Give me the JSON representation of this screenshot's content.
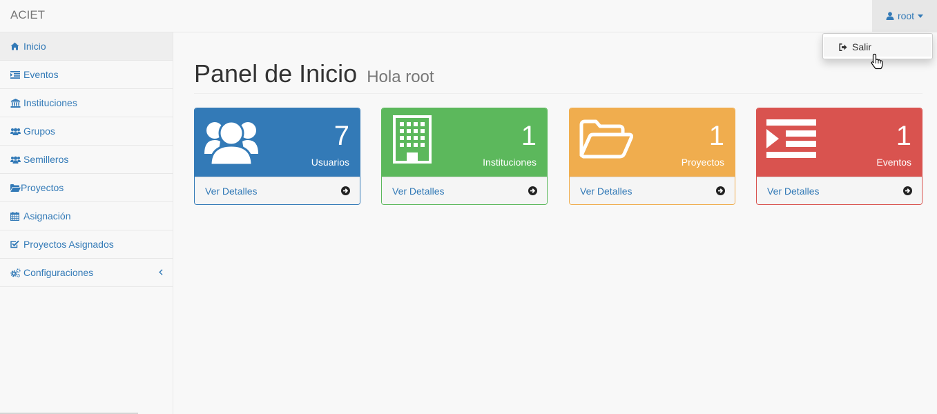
{
  "navbar": {
    "brand": "ACIET",
    "user_label": "root"
  },
  "dropdown": {
    "items": [
      {
        "label": "Salir",
        "icon": "sign-out-icon"
      }
    ]
  },
  "sidebar": {
    "items": [
      {
        "label": "Inicio",
        "icon": "home-icon",
        "active": true
      },
      {
        "label": "Eventos",
        "icon": "indent-icon"
      },
      {
        "label": "Instituciones",
        "icon": "bank-icon"
      },
      {
        "label": "Grupos",
        "icon": "users-icon"
      },
      {
        "label": "Semilleros",
        "icon": "users-icon"
      },
      {
        "label": "Proyectos",
        "icon": "folder-open-icon"
      },
      {
        "label": "Asignación",
        "icon": "calendar-icon"
      },
      {
        "label": "Proyectos Asignados",
        "icon": "check-square-icon"
      },
      {
        "label": "Configuraciones",
        "icon": "cogs-icon",
        "submenu_icon": "chevron-left-icon"
      }
    ]
  },
  "main": {
    "title": "Panel de Inicio",
    "subtitle": "Hola root",
    "panels": [
      {
        "count": "7",
        "label": "Usuarios",
        "footer": "Ver Detalles",
        "icon": "users-icon",
        "color": "#337ab7"
      },
      {
        "count": "1",
        "label": "Instituciones",
        "footer": "Ver Detalles",
        "icon": "building-icon",
        "color": "#5cb85c"
      },
      {
        "count": "1",
        "label": "Proyectos",
        "footer": "Ver Detalles",
        "icon": "folder-open-icon",
        "color": "#f0ad4e"
      },
      {
        "count": "1",
        "label": "Eventos",
        "footer": "Ver Detalles",
        "icon": "indent-icon",
        "color": "#d9534f"
      }
    ]
  }
}
